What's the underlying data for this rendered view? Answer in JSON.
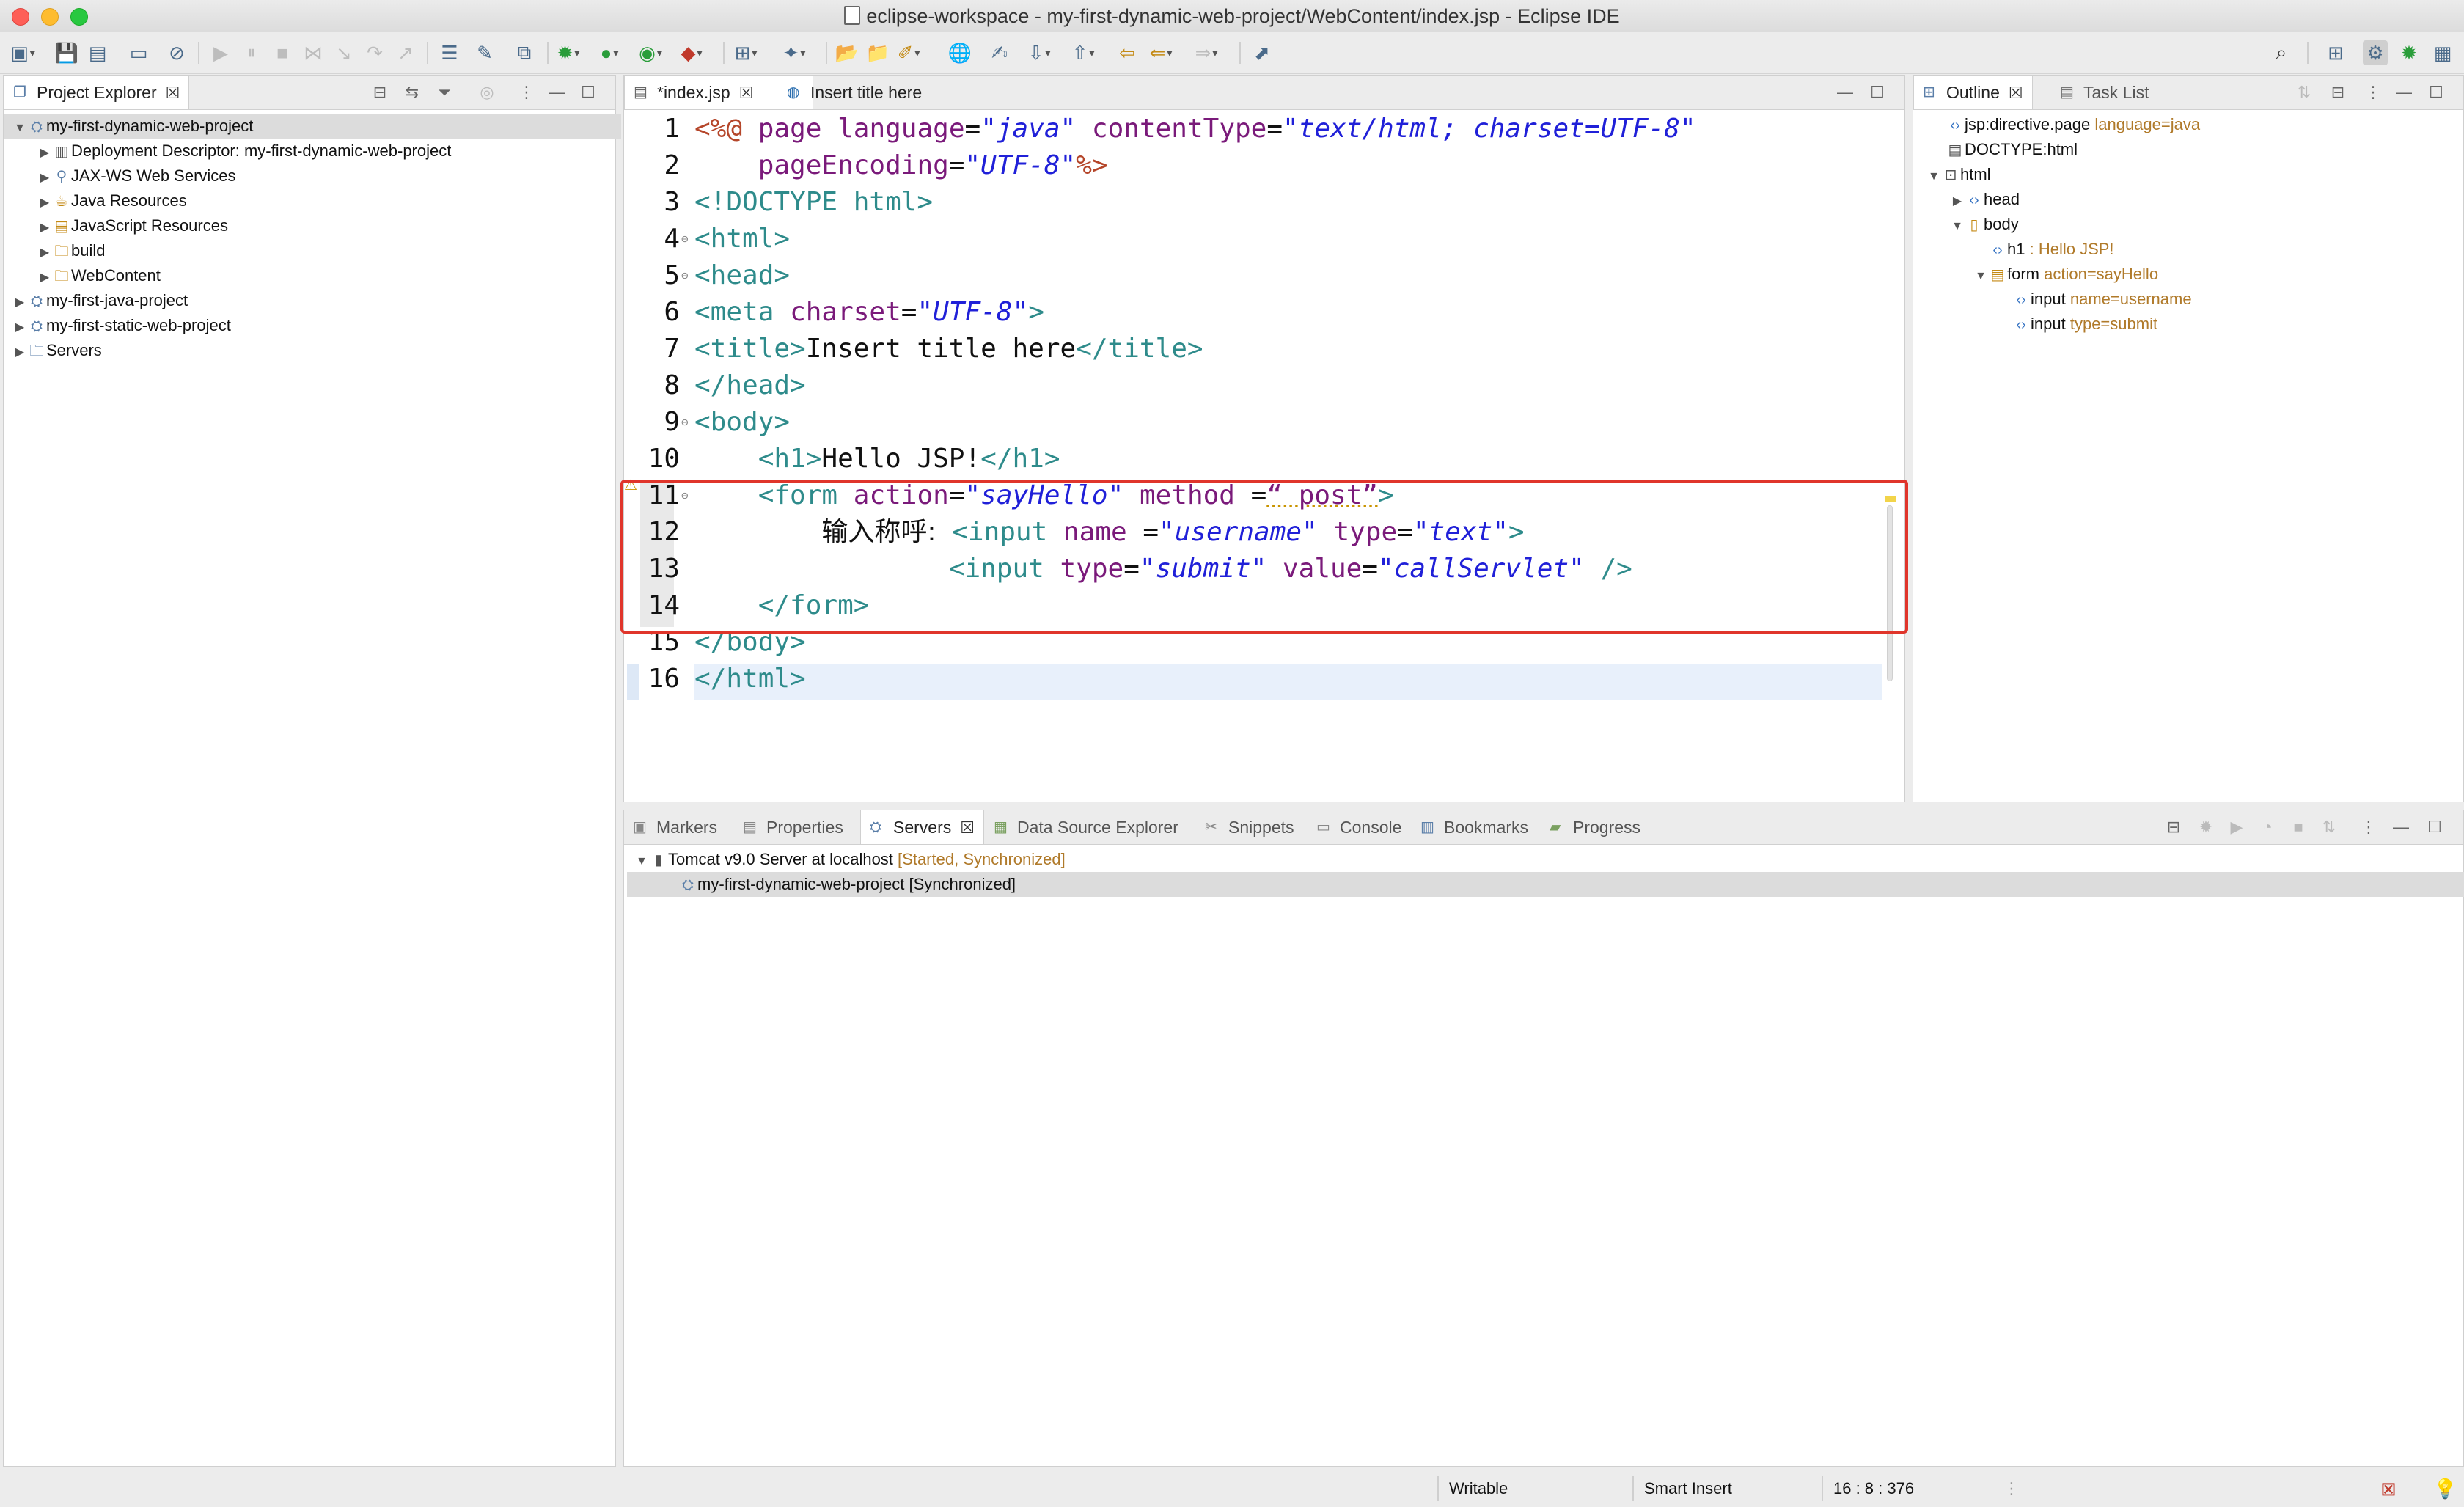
{
  "window": {
    "title": "eclipse-workspace - my-first-dynamic-web-project/WebContent/index.jsp - Eclipse IDE"
  },
  "project_explorer": {
    "tab_label": "Project Explorer",
    "items": [
      {
        "label": "my-first-dynamic-web-project",
        "level": 0,
        "expanded": true,
        "selected": true
      },
      {
        "label": "Deployment Descriptor: my-first-dynamic-web-project",
        "level": 1
      },
      {
        "label": "JAX-WS Web Services",
        "level": 1
      },
      {
        "label": "Java Resources",
        "level": 1
      },
      {
        "label": "JavaScript Resources",
        "level": 1
      },
      {
        "label": "build",
        "level": 1
      },
      {
        "label": "WebContent",
        "level": 1
      },
      {
        "label": "my-first-java-project",
        "level": 0
      },
      {
        "label": "my-first-static-web-project",
        "level": 0
      },
      {
        "label": "Servers",
        "level": 0
      }
    ]
  },
  "editor": {
    "tabs": [
      {
        "label": "*index.jsp",
        "active": true
      },
      {
        "label": "Insert title here",
        "active": false
      }
    ],
    "line_numbers": [
      "1",
      "2",
      "3",
      "4",
      "5",
      "6",
      "7",
      "8",
      "9",
      "10",
      "11",
      "12",
      "13",
      "14",
      "15",
      "16"
    ],
    "code": {
      "l1": {
        "jsp_open": "<%@",
        "kw": "page",
        "a1": "language",
        "eq": "=",
        "v1": "\"java\"",
        "a2": "contentType",
        "v2": "\"text/html; charset=UTF-8\""
      },
      "l2": {
        "a1": "pageEncoding",
        "eq": "=",
        "v1": "\"UTF-8\"",
        "jsp_close": "%>"
      },
      "l3": {
        "text": "<!DOCTYPE html>"
      },
      "l4": {
        "text": "<html>"
      },
      "l5": {
        "text": "<head>"
      },
      "l6": {
        "tag": "<meta",
        "a1": "charset",
        "eq": "=",
        "v1": "\"UTF-8\"",
        "end": ">"
      },
      "l7": {
        "open": "<title>",
        "text": "Insert title here",
        "close": "</title>"
      },
      "l8": {
        "text": "</head>"
      },
      "l9": {
        "text": "<body>"
      },
      "l10": {
        "open": "<h1>",
        "text": "Hello JSP!",
        "close": "</h1>"
      },
      "l11": {
        "tag": "<form",
        "a1": "action",
        "eq": "=",
        "v1": "\"sayHello\"",
        "a2": "method",
        "eq2": " =",
        "v2": "“ post”",
        "end": ">"
      },
      "l12": {
        "label": "输入称呼:",
        "tag": "<input",
        "a1": "name",
        "eq": " =",
        "v1": "\"username\"",
        "a2": "type",
        "eq2": "=",
        "v2": "\"text\"",
        "end": ">"
      },
      "l13": {
        "tag": "<input",
        "a1": "type",
        "eq": "=",
        "v1": "\"submit\"",
        "a2": "value",
        "eq2": "=",
        "v2": "\"callServlet\"",
        "end": " />"
      },
      "l14": {
        "text": "</form>"
      },
      "l15": {
        "text": "</body>"
      },
      "l16": {
        "text": "</html>"
      }
    }
  },
  "outline": {
    "tabs": [
      {
        "label": "Outline",
        "active": true
      },
      {
        "label": "Task List",
        "active": false
      }
    ],
    "items": [
      {
        "name": "jsp:directive.page",
        "attr": "language=java",
        "level": 0
      },
      {
        "name": "DOCTYPE:html",
        "attr": "",
        "level": 0
      },
      {
        "name": "html",
        "attr": "",
        "level": 0
      },
      {
        "name": "head",
        "attr": "",
        "level": 1
      },
      {
        "name": "body",
        "attr": "",
        "level": 1
      },
      {
        "name": "h1",
        "attr": " : Hello JSP!",
        "level": 2
      },
      {
        "name": "form",
        "attr": "action=sayHello",
        "level": 2
      },
      {
        "name": "input",
        "attr": "name=username",
        "level": 3
      },
      {
        "name": "input",
        "attr": "type=submit",
        "level": 3
      }
    ]
  },
  "bottom_panel": {
    "tabs": [
      "Markers",
      "Properties",
      "Servers",
      "Data Source Explorer",
      "Snippets",
      "Console",
      "Bookmarks",
      "Progress"
    ],
    "active_tab": "Servers",
    "server": {
      "name": "Tomcat v9.0 Server at localhost",
      "state": "[Started, Synchronized]"
    },
    "module": {
      "name": "my-first-dynamic-web-project",
      "state": "[Synchronized]"
    }
  },
  "status_bar": {
    "writable": "Writable",
    "insert_mode": "Smart Insert",
    "position": "16 : 8 : 376"
  },
  "colors": {
    "highlight_box": "#e0352b",
    "tag": "#2e8b8b",
    "attr_name": "#7a1a7a",
    "attr_value": "#2020d8"
  }
}
